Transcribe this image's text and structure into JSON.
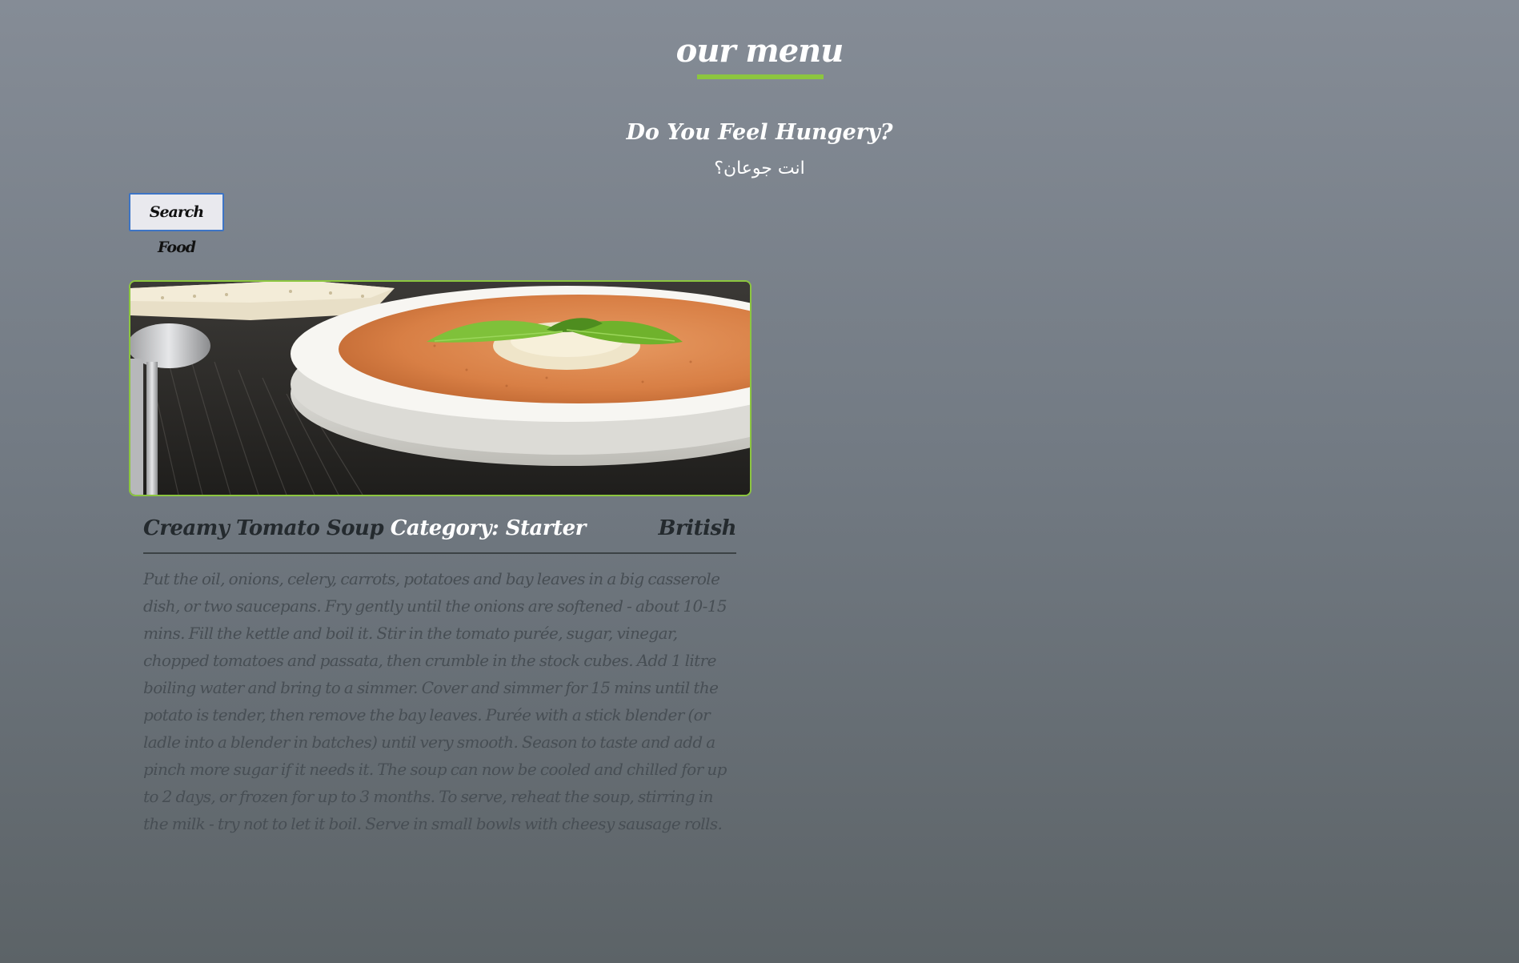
{
  "header": {
    "title": "our menu",
    "subtitle": "Do You Feel Hungery?",
    "arabic_subtitle": "انت جوعان؟"
  },
  "search": {
    "button_label": "Search Food"
  },
  "meal": {
    "name": "Creamy Tomato Soup",
    "category": "Category: Starter",
    "area": "British",
    "instructions": "Put the oil, onions, celery, carrots, potatoes and bay leaves in a big casserole dish, or two saucepans. Fry gently until the onions are softened - about 10-15 mins. Fill the kettle and boil it. Stir in the tomato purée, sugar, vinegar, chopped tomatoes and passata, then crumble in the stock cubes. Add 1 litre boiling water and bring to a simmer. Cover and simmer for 15 mins until the potato is tender, then remove the bay leaves. Purée with a stick blender (or ladle into a blender in batches) until very smooth. Season to taste and add a pinch more sugar if it needs it. The soup can now be cooled and chilled for up to 2 days, or frozen for up to 3 months. To serve, reheat the soup, stirring in the milk - try not to let it boil. Serve in small bowls with cheesy sausage rolls."
  },
  "colors": {
    "accent": "#8cc63f",
    "background_top": "#858c96",
    "background_bottom": "#5c6367",
    "heading_text": "#ffffff",
    "dark_text": "#242a2e",
    "body_text": "#474e54"
  }
}
